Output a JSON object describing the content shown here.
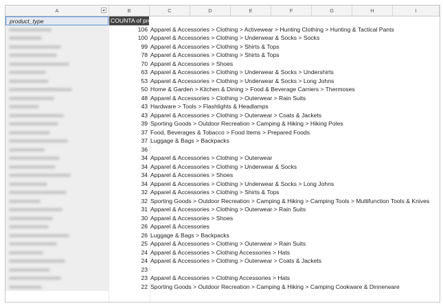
{
  "columns": [
    "A",
    "B",
    "C",
    "D",
    "E",
    "F",
    "G",
    "H",
    "I"
  ],
  "header_row": {
    "a": "product_type",
    "b": "COUNTA of prod"
  },
  "rows": [
    {
      "count": "106",
      "category": "Apparel & Accessories > Clothing > Activewear > Hunting Clothing > Hunting & Tactical Pants"
    },
    {
      "count": "100",
      "category": "Apparel & Accessories > Clothing > Underwear & Socks > Socks"
    },
    {
      "count": "99",
      "category": "Apparel & Accessories > Clothing > Shirts & Tops"
    },
    {
      "count": "78",
      "category": "Apparel & Accessories > Clothing > Shirts & Tops"
    },
    {
      "count": "70",
      "category": "Apparel & Accessories > Shoes"
    },
    {
      "count": "63",
      "category": "Apparel & Accessories > Clothing > Underwear & Socks > Undershirts"
    },
    {
      "count": "53",
      "category": "Apparel & Accessories > Clothing > Underwear & Socks > Long Johns"
    },
    {
      "count": "50",
      "category": "Home & Garden > Kitchen & Dining > Food & Beverage Carriers > Thermoses"
    },
    {
      "count": "48",
      "category": "Apparel & Accessories > Clothing > Outerwear > Rain Suits"
    },
    {
      "count": "43",
      "category": "Hardware > Tools > Flashlights & Headlamps"
    },
    {
      "count": "43",
      "category": "Apparel & Accessories > Clothing > Outerwear > Coats & Jackets"
    },
    {
      "count": "39",
      "category": "Sporting Goods > Outdoor Recreation > Camping & Hiking > Hiking Poles"
    },
    {
      "count": "37",
      "category": "Food, Beverages & Tobacco > Food Items > Prepared Foods"
    },
    {
      "count": "37",
      "category": "Luggage & Bags > Backpacks"
    },
    {
      "count": "36",
      "category": ""
    },
    {
      "count": "34",
      "category": "Apparel & Accessories > Clothing > Outerwear"
    },
    {
      "count": "34",
      "category": "Apparel & Accessories > Clothing > Underwear & Socks"
    },
    {
      "count": "34",
      "category": "Apparel & Accessories > Shoes"
    },
    {
      "count": "34",
      "category": "Apparel & Accessories > Clothing > Underwear & Socks > Long Johns"
    },
    {
      "count": "32",
      "category": "Apparel & Accessories > Clothing > Shirts & Tops"
    },
    {
      "count": "32",
      "category": "Sporting Goods > Outdoor Recreation > Camping & Hiking > Camping Tools > Multifunction Tools & Knives"
    },
    {
      "count": "31",
      "category": "Apparel & Accessories > Clothing > Outerwear > Rain Suits"
    },
    {
      "count": "30",
      "category": "Apparel & Accessories > Shoes"
    },
    {
      "count": "26",
      "category": "Apparel & Accessories"
    },
    {
      "count": "26",
      "category": "Luggage & Bags > Backpacks"
    },
    {
      "count": "25",
      "category": "Apparel & Accessories > Clothing > Outerwear > Rain Suits"
    },
    {
      "count": "24",
      "category": "Apparel & Accessories > Clothing Accessories > Hats"
    },
    {
      "count": "24",
      "category": "Apparel & Accessories > Clothing > Outerwear > Coats & Jackets"
    },
    {
      "count": "23",
      "category": ""
    },
    {
      "count": "23",
      "category": "Apparel & Accessories > Clothing Accessories > Hats"
    },
    {
      "count": "22",
      "category": "Sporting Goods > Outdoor Recreation > Camping & Hiking > Camping Cookware & Dinnerware"
    }
  ]
}
